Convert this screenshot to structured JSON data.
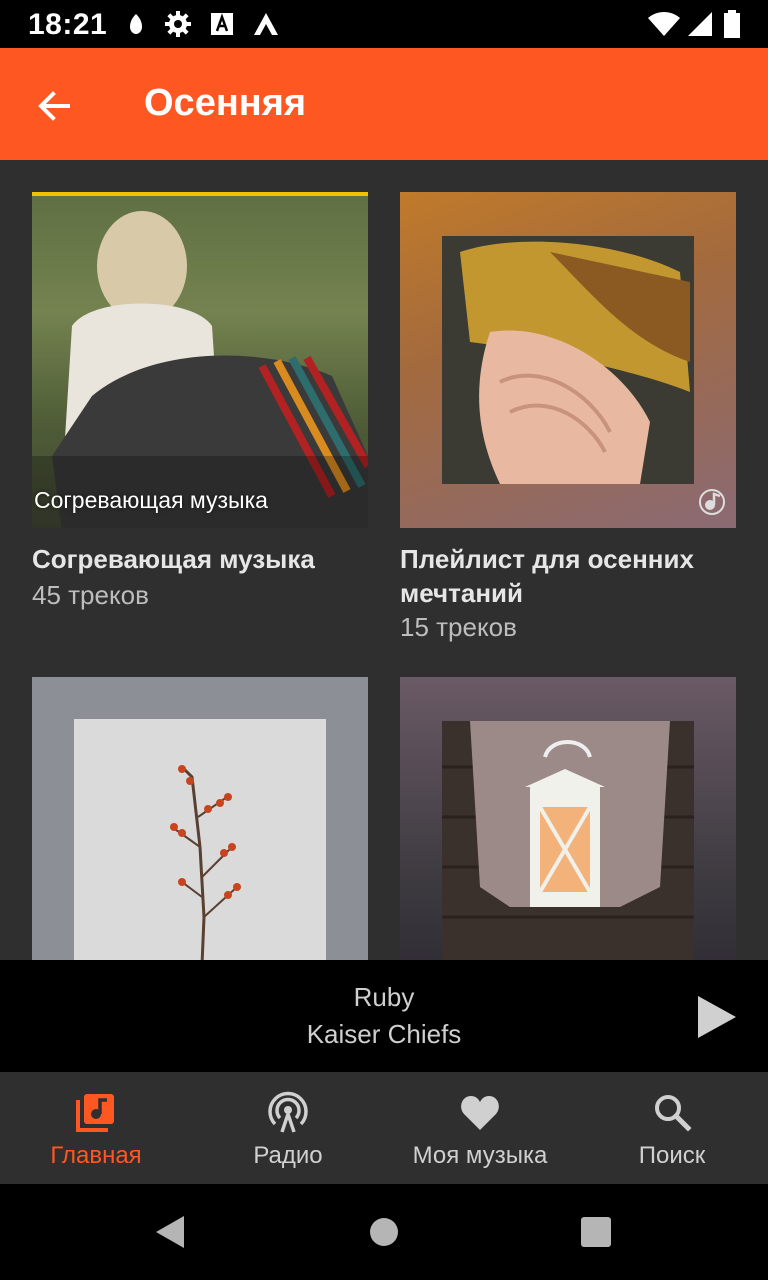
{
  "status_bar": {
    "time": "18:21",
    "icons_left": [
      "notification-icon",
      "settings-gear-icon",
      "text-a-icon",
      "app-logo-icon"
    ],
    "icons_right": [
      "wifi-icon",
      "signal-icon",
      "battery-icon"
    ]
  },
  "appbar": {
    "back_icon": "arrow-back-icon",
    "title": "Осенняя",
    "color": "#ff5722"
  },
  "playlists": [
    {
      "title": "Согревающая музыка",
      "count": "45 треков",
      "cover_caption": "Согревающая музыка"
    },
    {
      "title": "Плейлист для осенних мечтаний",
      "count": "15 треков",
      "badge_icon": "music-note-icon"
    },
    {
      "title": "",
      "count": ""
    },
    {
      "title": "",
      "count": ""
    }
  ],
  "player": {
    "track": "Ruby",
    "artist": "Kaiser Chiefs",
    "play_icon": "play-icon"
  },
  "bottom_nav": [
    {
      "label": "Главная",
      "icon": "library-music-icon",
      "active": true
    },
    {
      "label": "Радио",
      "icon": "podcast-radio-icon",
      "active": false
    },
    {
      "label": "Моя музыка",
      "icon": "heart-icon",
      "active": false
    },
    {
      "label": "Поиск",
      "icon": "search-icon",
      "active": false
    }
  ],
  "system_nav": [
    "back-triangle-icon",
    "home-circle-icon",
    "recents-square-icon"
  ]
}
